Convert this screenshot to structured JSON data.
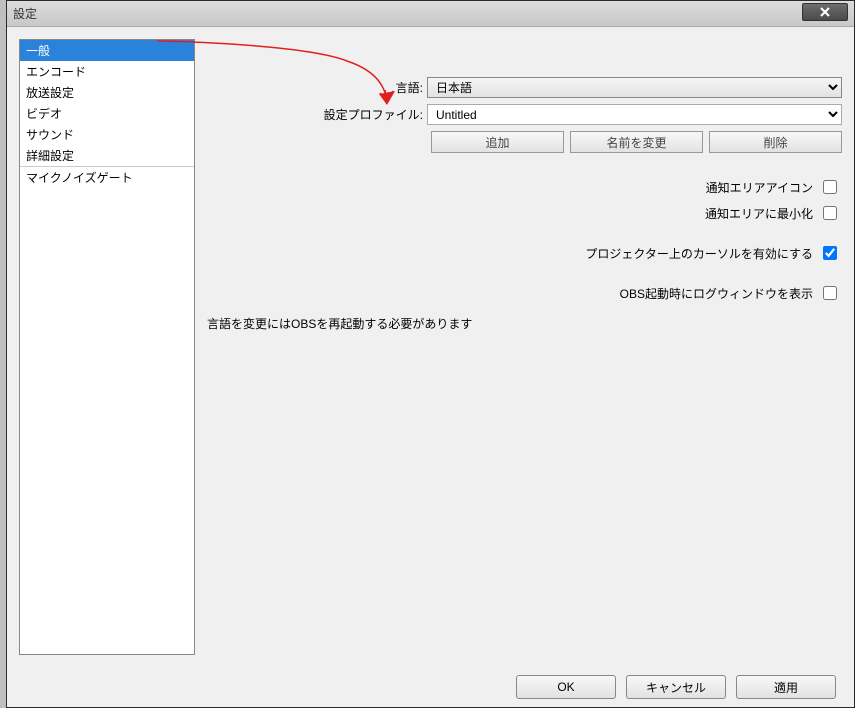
{
  "window": {
    "title": "設定"
  },
  "sidebar": {
    "items": [
      {
        "label": "一般",
        "sep": false
      },
      {
        "label": "エンコード",
        "sep": false
      },
      {
        "label": "放送設定",
        "sep": false
      },
      {
        "label": "ビデオ",
        "sep": false
      },
      {
        "label": "サウンド",
        "sep": false
      },
      {
        "label": "詳細設定",
        "sep": true
      },
      {
        "label": "マイクノイズゲート",
        "sep": false
      }
    ],
    "selected_index": 0
  },
  "form": {
    "lang_label": "言語:",
    "lang_value": "日本語",
    "profile_label": "設定プロファイル:",
    "profile_value": "Untitled",
    "btn_add": "追加",
    "btn_rename": "名前を変更",
    "btn_delete": "削除",
    "chk_tray_icon": {
      "label": "通知エリアアイコン",
      "checked": false
    },
    "chk_tray_min": {
      "label": "通知エリアに最小化",
      "checked": false
    },
    "chk_cursor": {
      "label": "プロジェクター上のカーソルを有効にする",
      "checked": true
    },
    "chk_logwin": {
      "label": "OBS起動時にログウィンドウを表示",
      "checked": false
    },
    "note": "言語を変更にはOBSを再起動する必要があります"
  },
  "footer": {
    "ok": "OK",
    "cancel": "キャンセル",
    "apply": "適用"
  },
  "colors": {
    "accent": "#2a82da",
    "arrow": "#e02020"
  }
}
